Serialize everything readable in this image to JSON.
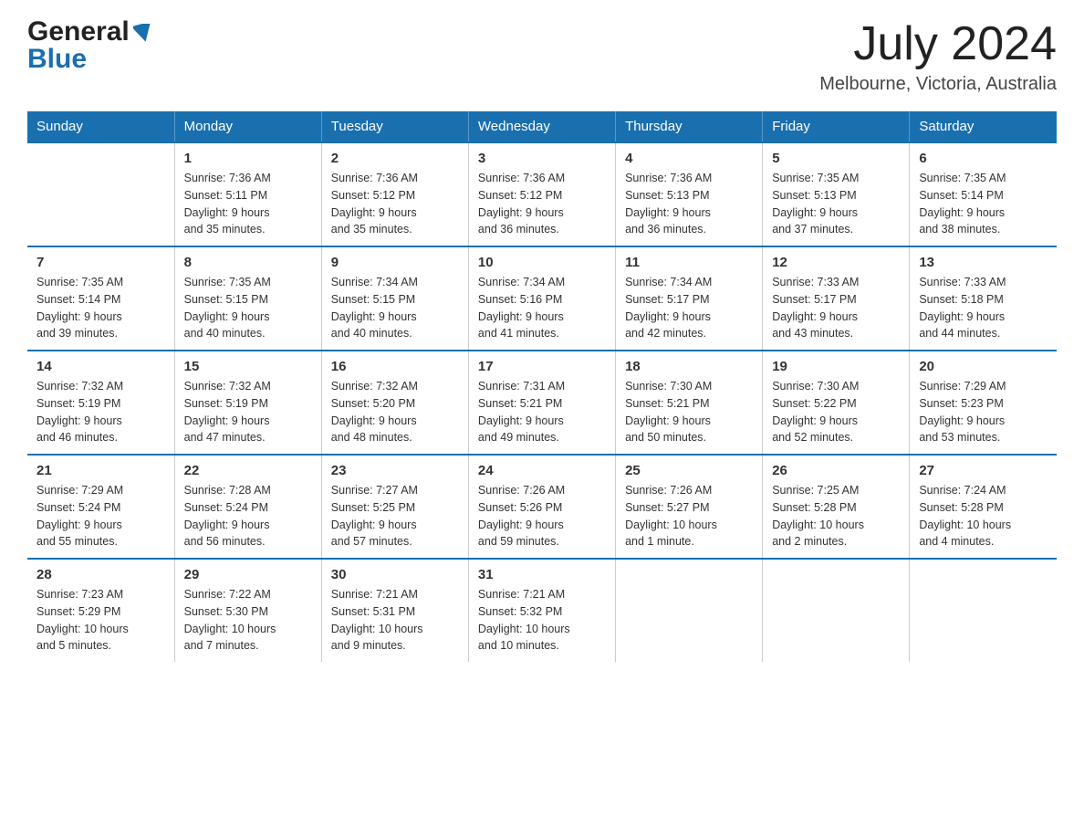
{
  "header": {
    "logo_general": "General",
    "logo_blue": "Blue",
    "month_year": "July 2024",
    "location": "Melbourne, Victoria, Australia"
  },
  "calendar": {
    "days_of_week": [
      "Sunday",
      "Monday",
      "Tuesday",
      "Wednesday",
      "Thursday",
      "Friday",
      "Saturday"
    ],
    "weeks": [
      [
        {
          "day": "",
          "info": ""
        },
        {
          "day": "1",
          "info": "Sunrise: 7:36 AM\nSunset: 5:11 PM\nDaylight: 9 hours\nand 35 minutes."
        },
        {
          "day": "2",
          "info": "Sunrise: 7:36 AM\nSunset: 5:12 PM\nDaylight: 9 hours\nand 35 minutes."
        },
        {
          "day": "3",
          "info": "Sunrise: 7:36 AM\nSunset: 5:12 PM\nDaylight: 9 hours\nand 36 minutes."
        },
        {
          "day": "4",
          "info": "Sunrise: 7:36 AM\nSunset: 5:13 PM\nDaylight: 9 hours\nand 36 minutes."
        },
        {
          "day": "5",
          "info": "Sunrise: 7:35 AM\nSunset: 5:13 PM\nDaylight: 9 hours\nand 37 minutes."
        },
        {
          "day": "6",
          "info": "Sunrise: 7:35 AM\nSunset: 5:14 PM\nDaylight: 9 hours\nand 38 minutes."
        }
      ],
      [
        {
          "day": "7",
          "info": "Sunrise: 7:35 AM\nSunset: 5:14 PM\nDaylight: 9 hours\nand 39 minutes."
        },
        {
          "day": "8",
          "info": "Sunrise: 7:35 AM\nSunset: 5:15 PM\nDaylight: 9 hours\nand 40 minutes."
        },
        {
          "day": "9",
          "info": "Sunrise: 7:34 AM\nSunset: 5:15 PM\nDaylight: 9 hours\nand 40 minutes."
        },
        {
          "day": "10",
          "info": "Sunrise: 7:34 AM\nSunset: 5:16 PM\nDaylight: 9 hours\nand 41 minutes."
        },
        {
          "day": "11",
          "info": "Sunrise: 7:34 AM\nSunset: 5:17 PM\nDaylight: 9 hours\nand 42 minutes."
        },
        {
          "day": "12",
          "info": "Sunrise: 7:33 AM\nSunset: 5:17 PM\nDaylight: 9 hours\nand 43 minutes."
        },
        {
          "day": "13",
          "info": "Sunrise: 7:33 AM\nSunset: 5:18 PM\nDaylight: 9 hours\nand 44 minutes."
        }
      ],
      [
        {
          "day": "14",
          "info": "Sunrise: 7:32 AM\nSunset: 5:19 PM\nDaylight: 9 hours\nand 46 minutes."
        },
        {
          "day": "15",
          "info": "Sunrise: 7:32 AM\nSunset: 5:19 PM\nDaylight: 9 hours\nand 47 minutes."
        },
        {
          "day": "16",
          "info": "Sunrise: 7:32 AM\nSunset: 5:20 PM\nDaylight: 9 hours\nand 48 minutes."
        },
        {
          "day": "17",
          "info": "Sunrise: 7:31 AM\nSunset: 5:21 PM\nDaylight: 9 hours\nand 49 minutes."
        },
        {
          "day": "18",
          "info": "Sunrise: 7:30 AM\nSunset: 5:21 PM\nDaylight: 9 hours\nand 50 minutes."
        },
        {
          "day": "19",
          "info": "Sunrise: 7:30 AM\nSunset: 5:22 PM\nDaylight: 9 hours\nand 52 minutes."
        },
        {
          "day": "20",
          "info": "Sunrise: 7:29 AM\nSunset: 5:23 PM\nDaylight: 9 hours\nand 53 minutes."
        }
      ],
      [
        {
          "day": "21",
          "info": "Sunrise: 7:29 AM\nSunset: 5:24 PM\nDaylight: 9 hours\nand 55 minutes."
        },
        {
          "day": "22",
          "info": "Sunrise: 7:28 AM\nSunset: 5:24 PM\nDaylight: 9 hours\nand 56 minutes."
        },
        {
          "day": "23",
          "info": "Sunrise: 7:27 AM\nSunset: 5:25 PM\nDaylight: 9 hours\nand 57 minutes."
        },
        {
          "day": "24",
          "info": "Sunrise: 7:26 AM\nSunset: 5:26 PM\nDaylight: 9 hours\nand 59 minutes."
        },
        {
          "day": "25",
          "info": "Sunrise: 7:26 AM\nSunset: 5:27 PM\nDaylight: 10 hours\nand 1 minute."
        },
        {
          "day": "26",
          "info": "Sunrise: 7:25 AM\nSunset: 5:28 PM\nDaylight: 10 hours\nand 2 minutes."
        },
        {
          "day": "27",
          "info": "Sunrise: 7:24 AM\nSunset: 5:28 PM\nDaylight: 10 hours\nand 4 minutes."
        }
      ],
      [
        {
          "day": "28",
          "info": "Sunrise: 7:23 AM\nSunset: 5:29 PM\nDaylight: 10 hours\nand 5 minutes."
        },
        {
          "day": "29",
          "info": "Sunrise: 7:22 AM\nSunset: 5:30 PM\nDaylight: 10 hours\nand 7 minutes."
        },
        {
          "day": "30",
          "info": "Sunrise: 7:21 AM\nSunset: 5:31 PM\nDaylight: 10 hours\nand 9 minutes."
        },
        {
          "day": "31",
          "info": "Sunrise: 7:21 AM\nSunset: 5:32 PM\nDaylight: 10 hours\nand 10 minutes."
        },
        {
          "day": "",
          "info": ""
        },
        {
          "day": "",
          "info": ""
        },
        {
          "day": "",
          "info": ""
        }
      ]
    ]
  }
}
